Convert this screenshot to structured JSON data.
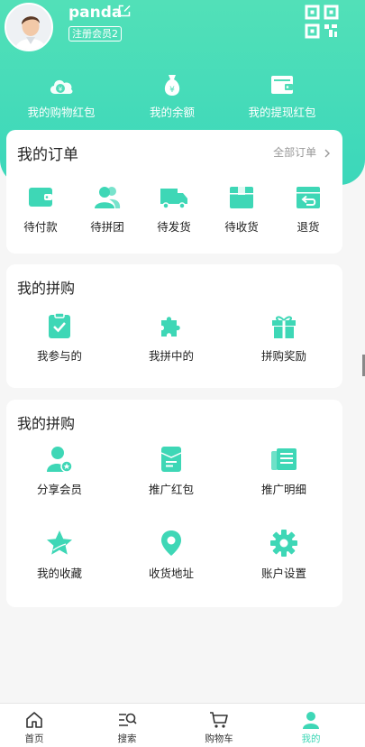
{
  "profile": {
    "username": "panda",
    "member_badge": "注册会员2"
  },
  "wallet": [
    {
      "label": "我的购物红包",
      "icon": "cloud-coin-icon"
    },
    {
      "label": "我的余额",
      "icon": "money-bag-icon"
    },
    {
      "label": "我的提现红包",
      "icon": "wallet-icon"
    }
  ],
  "orders": {
    "title": "我的订单",
    "all_link": "全部订单",
    "items": [
      {
        "label": "待付款",
        "icon": "wallet-pay-icon"
      },
      {
        "label": "待拼团",
        "icon": "group-users-icon"
      },
      {
        "label": "待发货",
        "icon": "truck-icon"
      },
      {
        "label": "待收货",
        "icon": "box-icon"
      },
      {
        "label": "退货",
        "icon": "return-icon"
      }
    ]
  },
  "group_buy": {
    "title": "我的拼购",
    "items": [
      {
        "label": "我参与的",
        "icon": "clipboard-check-icon"
      },
      {
        "label": "我拼中的",
        "icon": "puzzle-icon"
      },
      {
        "label": "拼购奖励",
        "icon": "gift-icon"
      }
    ]
  },
  "group_buy_2": {
    "title": "我的拼购",
    "items": [
      {
        "label": "分享会员",
        "icon": "user-star-icon"
      },
      {
        "label": "推广红包",
        "icon": "red-packet-icon"
      },
      {
        "label": "推广明细",
        "icon": "newspaper-icon"
      },
      {
        "label": "我的收藏",
        "icon": "star-icon"
      },
      {
        "label": "收货地址",
        "icon": "location-pin-icon"
      },
      {
        "label": "账户设置",
        "icon": "gear-icon"
      }
    ]
  },
  "tabbar": [
    {
      "label": "首页",
      "icon": "home-icon"
    },
    {
      "label": "搜索",
      "icon": "search-icon"
    },
    {
      "label": "购物车",
      "icon": "cart-icon"
    },
    {
      "label": "我的",
      "icon": "user-icon"
    }
  ],
  "colors": {
    "accent": "#3ed7b6",
    "header_top": "#52e0b8",
    "background": "#f6f6f6"
  }
}
